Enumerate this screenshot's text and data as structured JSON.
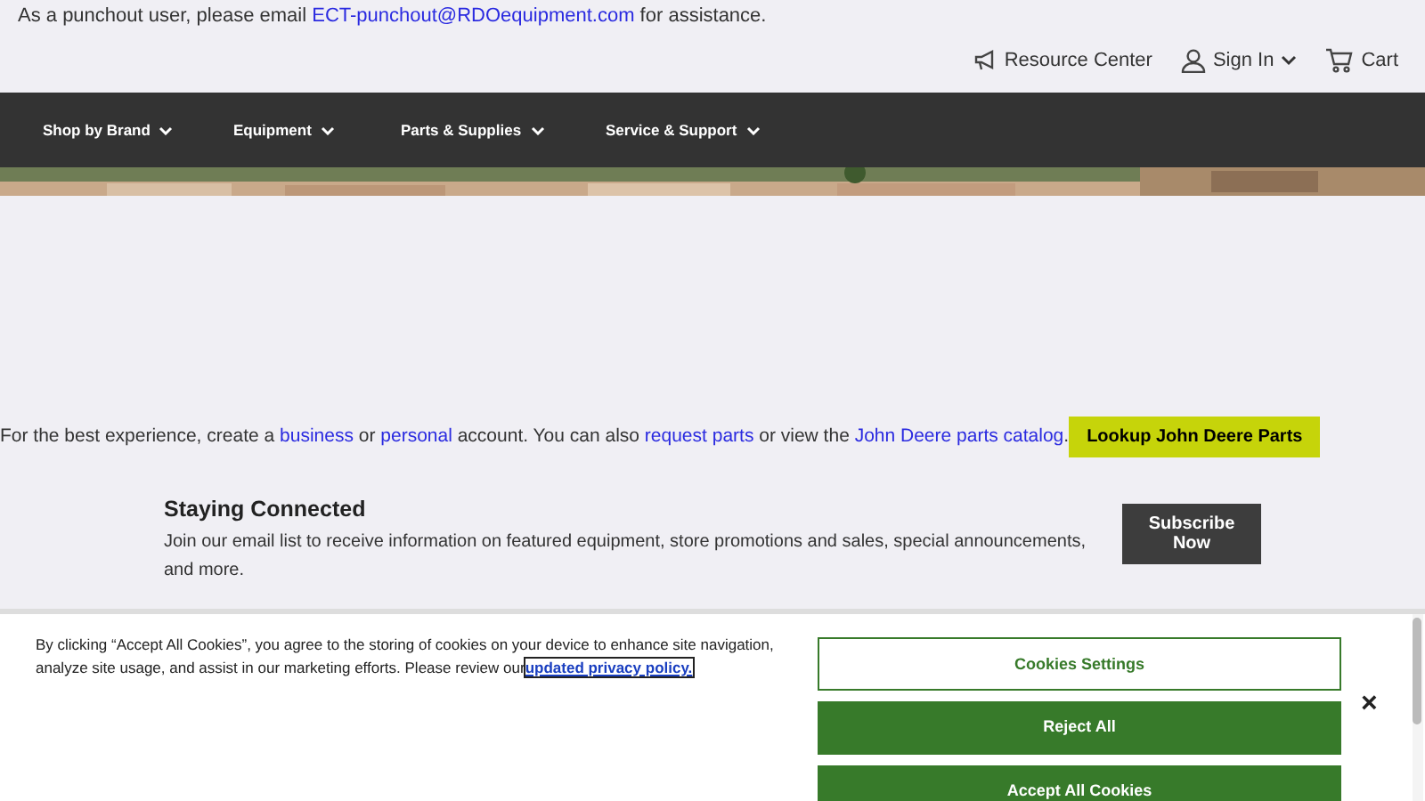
{
  "notice": {
    "before": "As a punchout user, please email ",
    "email": "ECT-punchout@RDOequipment.com",
    "after": " for assistance."
  },
  "utility_links": [
    {
      "label": "Resource Center",
      "caret": false
    },
    {
      "label": "Sign In",
      "caret": true
    },
    {
      "label": "Cart",
      "caret": false
    }
  ],
  "nav": [
    {
      "label": "Shop by Brand"
    },
    {
      "label": "Equipment"
    },
    {
      "label": "Parts & Supplies"
    },
    {
      "label": "Service & Support"
    }
  ],
  "account_line": [
    {
      "kind": "text",
      "text": "For the best experience, create a "
    },
    {
      "kind": "link",
      "text": "business"
    },
    {
      "kind": "text",
      "text": " or "
    },
    {
      "kind": "link",
      "text": "personal"
    },
    {
      "kind": "text",
      "text": " account. You can also "
    },
    {
      "kind": "link",
      "text": "request parts"
    },
    {
      "kind": "text",
      "text": " or view the "
    },
    {
      "kind": "link",
      "text": "John Deere parts catalog"
    },
    {
      "kind": "text",
      "text": "."
    }
  ],
  "lookup_button": "Lookup John Deere Parts",
  "newsletter": {
    "title": "Staying Connected",
    "text": "Join our email list to receive information on featured equipment, store promotions and sales, special announcements, and more.",
    "button": "Subscribe Now"
  },
  "cookie_banner": {
    "text": "By clicking “Accept All Cookies”, you agree to the storing of cookies on your device to enhance site navigation, analyze site usage, and assist in our marketing efforts. Please review our",
    "link": "updated privacy policy.",
    "buttons": [
      {
        "label": "Cookies Settings",
        "kind": "outline"
      },
      {
        "label": "Reject All",
        "kind": "solid"
      },
      {
        "label": "Accept All Cookies",
        "kind": "solid"
      }
    ],
    "close": "×"
  }
}
